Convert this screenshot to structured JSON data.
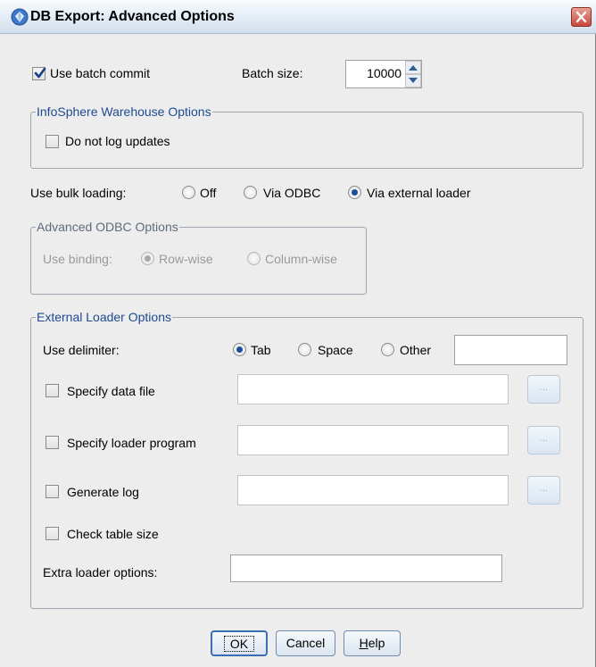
{
  "window": {
    "title": "DB Export: Advanced Options"
  },
  "batch": {
    "use_batch_commit_label": "Use batch commit",
    "use_batch_commit_checked": true,
    "batch_size_label": "Batch size:",
    "batch_size_value": "10000"
  },
  "infosphere": {
    "group_title": "InfoSphere Warehouse Options",
    "do_not_log_label": "Do not log updates",
    "do_not_log_checked": false
  },
  "bulk_loading": {
    "label": "Use bulk loading:",
    "options": [
      "Off",
      "Via ODBC",
      "Via external loader"
    ],
    "selected": "Via external loader"
  },
  "odbc": {
    "group_title": "Advanced ODBC Options",
    "use_binding_label": "Use binding:",
    "options": [
      "Row-wise",
      "Column-wise"
    ],
    "selected": "Row-wise",
    "enabled": false
  },
  "external_loader": {
    "group_title": "External Loader Options",
    "delimiter_label": "Use delimiter:",
    "delimiter_options": [
      "Tab",
      "Space",
      "Other"
    ],
    "delimiter_selected": "Tab",
    "delimiter_other_value": "",
    "specify_data_file_label": "Specify data file",
    "specify_data_file_value": "",
    "specify_loader_program_label": "Specify loader program",
    "specify_loader_program_value": "",
    "generate_log_label": "Generate log",
    "generate_log_value": "",
    "browse_label": "...",
    "check_table_size_label": "Check table size",
    "extra_options_label": "Extra loader options:",
    "extra_options_value": ""
  },
  "buttons": {
    "ok": "OK",
    "cancel": "Cancel",
    "help_prefix": "",
    "help_underlined": "H",
    "help_rest": "elp"
  },
  "colors": {
    "accent": "#1f4a8f",
    "close": "#c5493a",
    "radio_dot": "#1a4d9a"
  }
}
